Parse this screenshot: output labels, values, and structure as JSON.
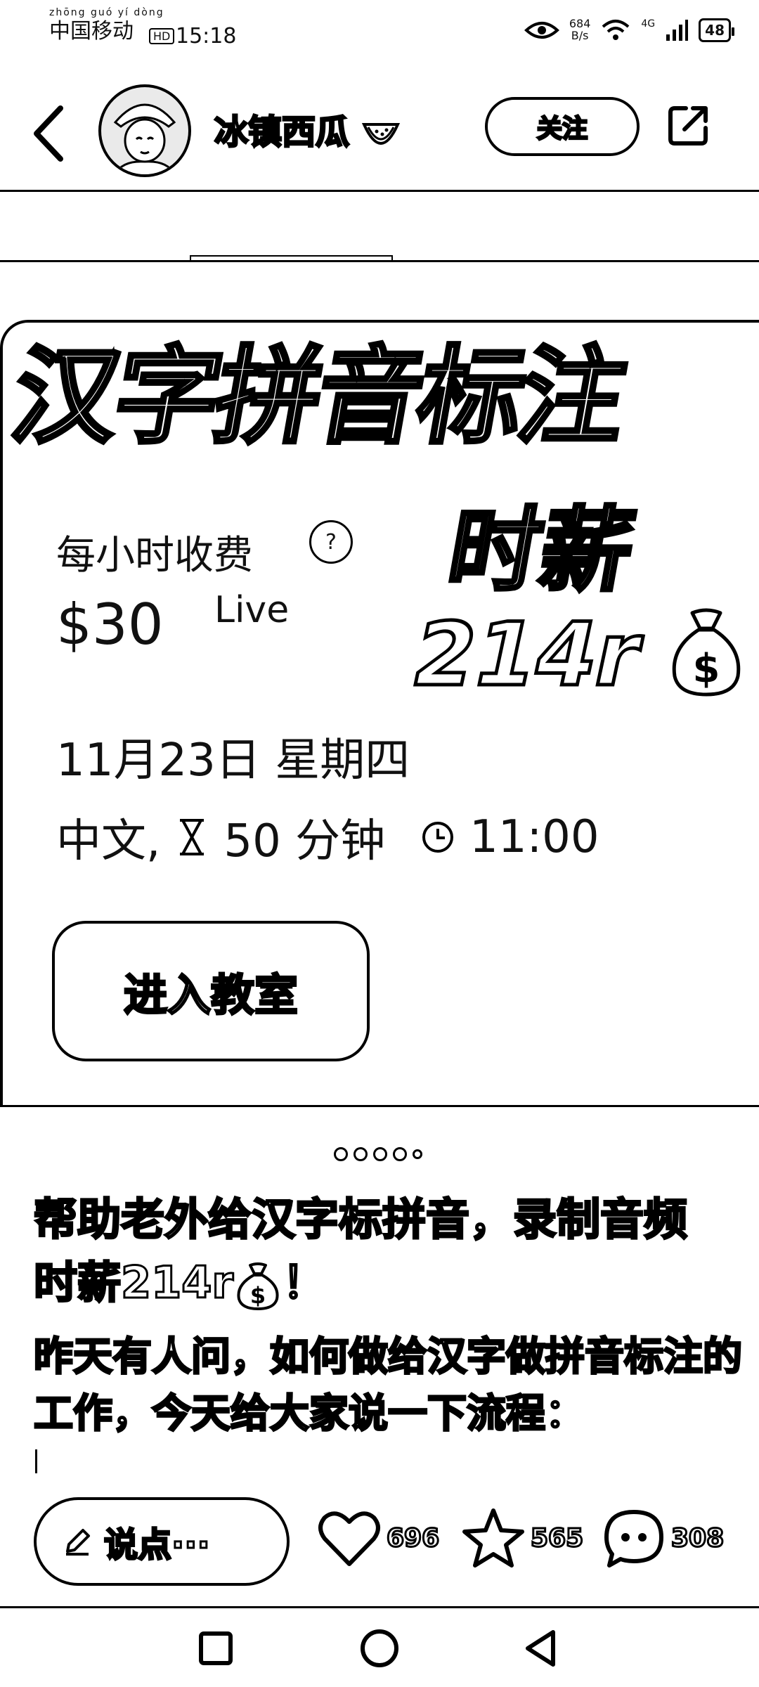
{
  "status_bar": {
    "carrier_pinyin": "zhōng guó yí dòng",
    "carrier": "中国移动",
    "hd": "HD",
    "time": "15:18",
    "net_speed_value": "684",
    "net_speed_unit": "B/s",
    "network": "4G",
    "battery": "48"
  },
  "header": {
    "username": "冰镇西瓜",
    "follow_label": "关注"
  },
  "card": {
    "hero_title": "汉字拼音标注",
    "fee_label": "每小时收费",
    "help_glyph": "?",
    "price": "$30",
    "live": "Live",
    "wage_title": "时薪",
    "wage_value": "214r",
    "date": "11月23日 星期四",
    "language": "中文,",
    "duration": "50 分钟",
    "start_time": "11:00",
    "enter_button": "进入教室"
  },
  "post": {
    "title_line1": "帮助老外给汉字标拼音，录制音频",
    "title_line2_prefix": "时薪214r",
    "title_line2_suffix": "！",
    "body": "昨天有人问，如何做给汉字做拼音标注的工作，今天给大家说一下流程："
  },
  "actions": {
    "comment_placeholder": "说点···",
    "likes": "696",
    "favorites": "565",
    "comments": "308"
  }
}
